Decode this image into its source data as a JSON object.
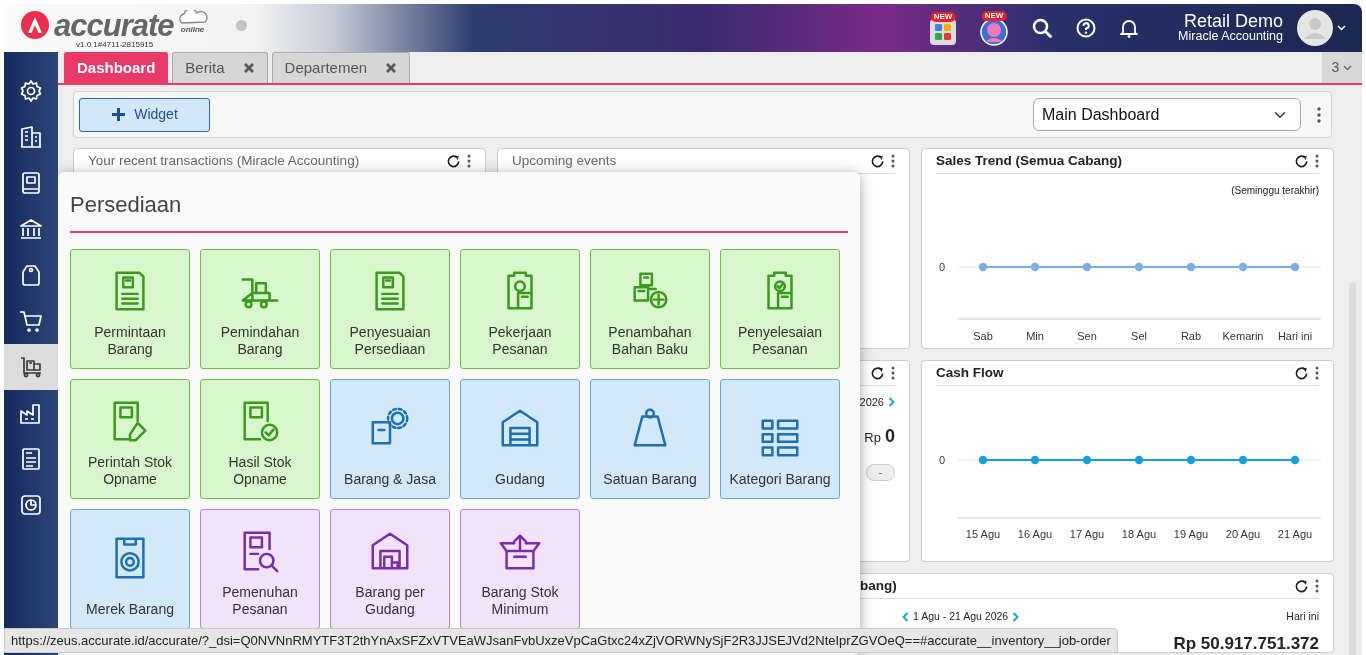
{
  "header": {
    "logo_text": "accurate",
    "logo_sub": "online",
    "version": "v1.0.1#4711-2815915",
    "apps_badge": "NEW",
    "assistant_badge": "NEW",
    "user_name": "Retail Demo",
    "company": "Miracle Accounting"
  },
  "sidebar": {
    "items": [
      {
        "selected": false
      },
      {
        "selected": false
      },
      {
        "selected": false
      },
      {
        "selected": false
      },
      {
        "selected": false
      },
      {
        "selected": false
      },
      {
        "selected": true
      },
      {
        "selected": false
      },
      {
        "selected": false
      },
      {
        "selected": false
      }
    ]
  },
  "tabs": [
    {
      "label": "Dashboard",
      "selected": true,
      "closable": false
    },
    {
      "label": "Berita",
      "selected": false,
      "closable": true
    },
    {
      "label": "Departemen",
      "selected": false,
      "closable": true
    }
  ],
  "tab_count": "3",
  "toolbar": {
    "add_button": "Widget",
    "dashboard_select": "Main Dashboard"
  },
  "widgets": {
    "recent_transactions": {
      "title": "Your recent transactions (Miracle Accounting)"
    },
    "upcoming_events": {
      "title": "Upcoming events"
    },
    "summary": {
      "date_range": "2026",
      "currency": "Rp",
      "amount": "0",
      "pill": "-"
    },
    "sales_by_branch": {
      "title": "bang)",
      "date_range": "1 Agu - 21 Agu 2026",
      "period": "Hari ini",
      "amount": "Rp 50.917.751.372"
    },
    "sales_trend": {
      "title": "Sales Trend (Semua Cabang)",
      "note": "(Seminggu terakhir)",
      "axis_label": "0",
      "x_labels": [
        "Sab",
        "Min",
        "Sen",
        "Sel",
        "Rab",
        "Kemarin",
        "Hari ini"
      ]
    },
    "cash_flow": {
      "title": "Cash Flow",
      "axis_label": "0",
      "x_labels": [
        "15 Agu",
        "16 Agu",
        "17 Agu",
        "18 Agu",
        "19 Agu",
        "20 Agu",
        "21 Agu"
      ]
    }
  },
  "popup": {
    "title": "Persediaan",
    "tiles": [
      {
        "label": "Permintaan Barang",
        "kind": "transaction"
      },
      {
        "label": "Pemindahan Barang",
        "kind": "transaction"
      },
      {
        "label": "Penyesuaian Persediaan",
        "kind": "transaction"
      },
      {
        "label": "Pekerjaan Pesanan",
        "kind": "transaction"
      },
      {
        "label": "Penambahan Bahan Baku",
        "kind": "transaction"
      },
      {
        "label": "Penyelesaian Pesanan",
        "kind": "transaction"
      },
      {
        "label": "Perintah Stok Opname",
        "kind": "transaction"
      },
      {
        "label": "Hasil Stok Opname",
        "kind": "transaction"
      },
      {
        "label": "Barang & Jasa",
        "kind": "master"
      },
      {
        "label": "Gudang",
        "kind": "master"
      },
      {
        "label": "Satuan Barang",
        "kind": "master"
      },
      {
        "label": "Kategori Barang",
        "kind": "master"
      },
      {
        "label": "Merek Barang",
        "kind": "master"
      },
      {
        "label": "Pemenuhan Pesanan",
        "kind": "report"
      },
      {
        "label": "Barang per Gudang",
        "kind": "report"
      },
      {
        "label": "Barang Stok Minimum",
        "kind": "report"
      }
    ]
  },
  "status_url": "https://zeus.accurate.id/accurate/?_dsi=Q0NVNnRMYTF3T2thYnAxSFZxVTVEaWJsanFvbUxzeVpCaGtxc24xZjVORWNySjF2R3JJSEJVd2NteIprZGVOeQ==#accurate__inventory__job-order"
}
